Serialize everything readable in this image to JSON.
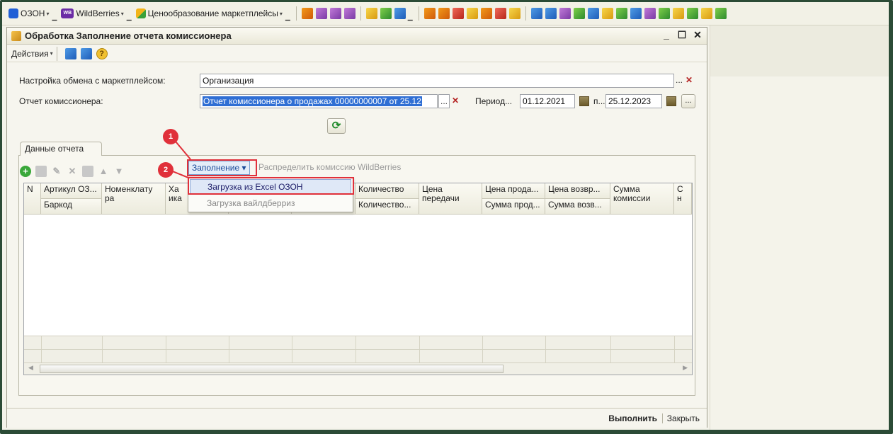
{
  "toolbar": {
    "menus": [
      {
        "label": "ОЗОН",
        "icon": "ozon-logo-icon"
      },
      {
        "label": "WildBerries",
        "icon": "wildberries-logo-icon",
        "badge": "WB"
      },
      {
        "label": "Ценообразование маркетплейсы",
        "icon": "pricing-icon"
      }
    ]
  },
  "window": {
    "title": "Обработка  Заполнение отчета комиссионера",
    "controls": {
      "minimize": "_",
      "maximize": "☐",
      "close": "✕"
    }
  },
  "actions": {
    "label": "Действия",
    "help": "?"
  },
  "form": {
    "exchange_label": "Настройка обмена с маркетплейсом:",
    "exchange_value": "Организация",
    "report_label": "Отчет комиссионера:",
    "report_value": "Отчет комиссионера о продажах 00000000007 от 25.12",
    "period_label": "Период...",
    "period_from": "01.12.2021",
    "period_to_label": "п...",
    "period_to": "25.12.2023",
    "ellipsis": "...",
    "clear": "✕"
  },
  "tab": {
    "label": "Данные отчета"
  },
  "table_toolbar": {
    "fill_label": "Заполнение",
    "distribute_label": "Распределить комиссию WildBerries"
  },
  "dropdown": {
    "items": [
      {
        "label": "Загрузка из Excel ОЗОН",
        "state": "active"
      },
      {
        "label": "Загрузка вайлдберриз",
        "state": "dim"
      }
    ]
  },
  "table": {
    "columns": [
      {
        "top": "N",
        "bottom": ""
      },
      {
        "top": "Артикул ОЗ...",
        "bottom": "Баркод"
      },
      {
        "top": "Номенклату",
        "bottom": "ра"
      },
      {
        "top": "Ха",
        "bottom": "ика"
      },
      {
        "top": "",
        "bottom": ""
      },
      {
        "top": "",
        "bottom": ""
      },
      {
        "top": "Количество",
        "bottom": "Количество..."
      },
      {
        "top": "Цена",
        "bottom": "передачи"
      },
      {
        "top": "Цена прода...",
        "bottom": "Сумма прод..."
      },
      {
        "top": "Цена возвр...",
        "bottom": "Сумма возв..."
      },
      {
        "top": "Сумма",
        "bottom": "комиссии"
      },
      {
        "top": "С",
        "bottom": "н"
      }
    ]
  },
  "markers": [
    "1",
    "2"
  ],
  "footer": {
    "execute": "Выполнить",
    "close": "Закрыть"
  },
  "colors": {
    "accent": "#e0303a",
    "selection": "#2f6ed4",
    "frame": "#2b4b36"
  }
}
